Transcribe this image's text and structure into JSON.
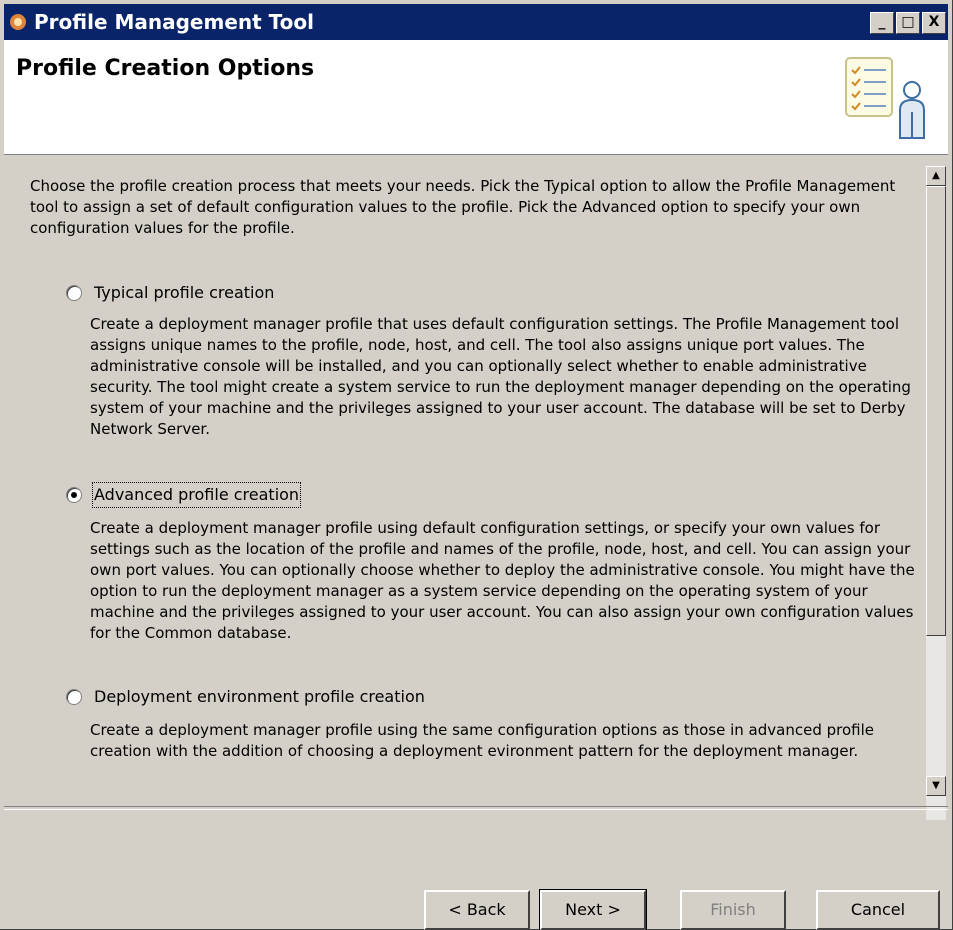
{
  "window": {
    "title": "Profile Management Tool",
    "controls": [
      "_",
      "□",
      "X"
    ]
  },
  "header": {
    "title": "Profile Creation Options",
    "art_icon": "checklist-person-icon"
  },
  "intro": "Choose the profile creation process that meets your needs. Pick the Typical option to allow the Profile Management tool to assign a set of default configuration values to the profile. Pick the Advanced option to specify your own configuration values for the profile.",
  "options": [
    {
      "label": "Typical profile creation",
      "selected": false,
      "description": "Create a deployment manager profile that uses default configuration settings. The Profile Management tool assigns unique names to the profile, node, host, and cell. The tool also assigns unique port values. The administrative console will be installed, and you can optionally select whether to enable administrative security. The tool might create a system service to run the deployment manager depending on the operating system of your machine and the privileges assigned to your user account. The database will be set to Derby Network Server."
    },
    {
      "label": "Advanced profile creation",
      "selected": true,
      "description": "Create a deployment manager profile using default configuration settings, or specify your own values for settings such as the location of the profile and names of the profile, node, host, and cell. You can assign your own port values. You can optionally choose whether to deploy the administrative console. You might have the option to run the deployment manager as a system service depending on the operating system of your machine and the privileges assigned to your user account. You can also assign your own configuration values for the Common database."
    },
    {
      "label": "Deployment environment profile creation",
      "selected": false,
      "description": "Create a deployment manager profile using the same configuration options as those in advanced profile creation with the addition of choosing a deployment evironment pattern for the deployment manager."
    }
  ],
  "buttons": {
    "back": "< Back",
    "next": "Next >",
    "finish": "Finish",
    "cancel": "Cancel"
  },
  "colors": {
    "titlebar": "#0a246a",
    "dialog_bg": "#d4d0c8",
    "header_bg": "#ffffff"
  }
}
